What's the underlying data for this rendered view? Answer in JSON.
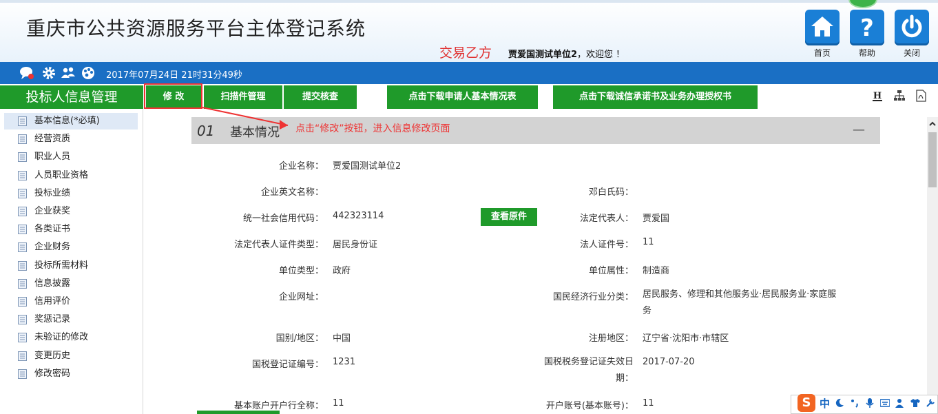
{
  "header": {
    "app_title": "重庆市公共资源服务平台主体登记系统",
    "role": "交易乙方",
    "user_name": "贾爱国测试单位2",
    "welcome": "，欢迎您 ！",
    "buttons": [
      {
        "label": "首页",
        "icon": "home-icon"
      },
      {
        "label": "帮助",
        "icon": "help-icon"
      },
      {
        "label": "关闭",
        "icon": "power-icon"
      }
    ],
    "accent_color": "#1a7fd6"
  },
  "statusbar": {
    "datetime": "2017年07月24日 21时31分49秒",
    "icons": [
      "chat-icon",
      "gear-icon",
      "users-icon",
      "palette-icon"
    ]
  },
  "section_title": "投标人信息管理",
  "toolbar": {
    "edit": "修  改",
    "scan": "扫描件管理",
    "submit": "提交核查",
    "download_basic": "点击下载申请人基本情况表",
    "download_letter": "点击下载诚信承诺书及业务办理授权书",
    "right_icons": [
      "h-icon",
      "org-chart-icon",
      "pdf-icon"
    ],
    "color": "#1f9a2a"
  },
  "sidebar": {
    "items": [
      {
        "label": "基本信息(*必填)",
        "active": true
      },
      {
        "label": "经营资质"
      },
      {
        "label": "职业人员"
      },
      {
        "label": "人员职业资格"
      },
      {
        "label": "投标业绩"
      },
      {
        "label": "企业获奖"
      },
      {
        "label": "各类证书"
      },
      {
        "label": "企业财务"
      },
      {
        "label": "投标所需材料"
      },
      {
        "label": "信息披露"
      },
      {
        "label": "信用评价"
      },
      {
        "label": "奖惩记录"
      },
      {
        "label": "未验证的修改"
      },
      {
        "label": "变更历史"
      },
      {
        "label": "修改密码"
      }
    ]
  },
  "panel": {
    "number": "01",
    "title": "基本情况",
    "collapse": "—",
    "annotation": "点击“修改”按钮，进入信息修改页面",
    "view_original": "查看原件",
    "fields": {
      "company_name": {
        "label": "企业名称：",
        "value": "贾爱国测试单位2"
      },
      "english_name": {
        "label": "企业英文名称：",
        "value": ""
      },
      "duns": {
        "label": "邓白氏码：",
        "value": ""
      },
      "credit_code": {
        "label": "统一社会信用代码：",
        "value": "442323114"
      },
      "legal_rep": {
        "label": "法定代表人：",
        "value": "贾爱国"
      },
      "rep_id_type": {
        "label": "法定代表人证件类型：",
        "value": "居民身份证"
      },
      "rep_id_no": {
        "label": "法人证件号：",
        "value": "11"
      },
      "unit_type": {
        "label": "单位类型：",
        "value": "政府"
      },
      "unit_attr": {
        "label": "单位属性：",
        "value": "制造商"
      },
      "website": {
        "label": "企业网址：",
        "value": ""
      },
      "industry": {
        "label": "国民经济行业分类：",
        "value": "居民服务、修理和其他服务业·居民服务业·家庭服务"
      },
      "country": {
        "label": "国别/地区：",
        "value": "中国"
      },
      "reg_area": {
        "label": "注册地区：",
        "value": "辽宁省·沈阳市·市辖区"
      },
      "tax_no": {
        "label": "国税登记证编号：",
        "value": "1231"
      },
      "tax_expire": {
        "label": "国税税务登记证失效日期：",
        "value": "2017-07-20"
      },
      "bank_name": {
        "label": "基本账户开户行全称：",
        "value": "11"
      },
      "account_no": {
        "label": "开户账号(基本账号)：",
        "value": "11"
      }
    }
  },
  "ime": {
    "logo": "S",
    "mode": "中",
    "icons": [
      "moon-icon",
      "punct-icon",
      "mic-icon",
      "keyboard-icon",
      "user-icon",
      "shirt-icon",
      "tools-icon"
    ]
  }
}
